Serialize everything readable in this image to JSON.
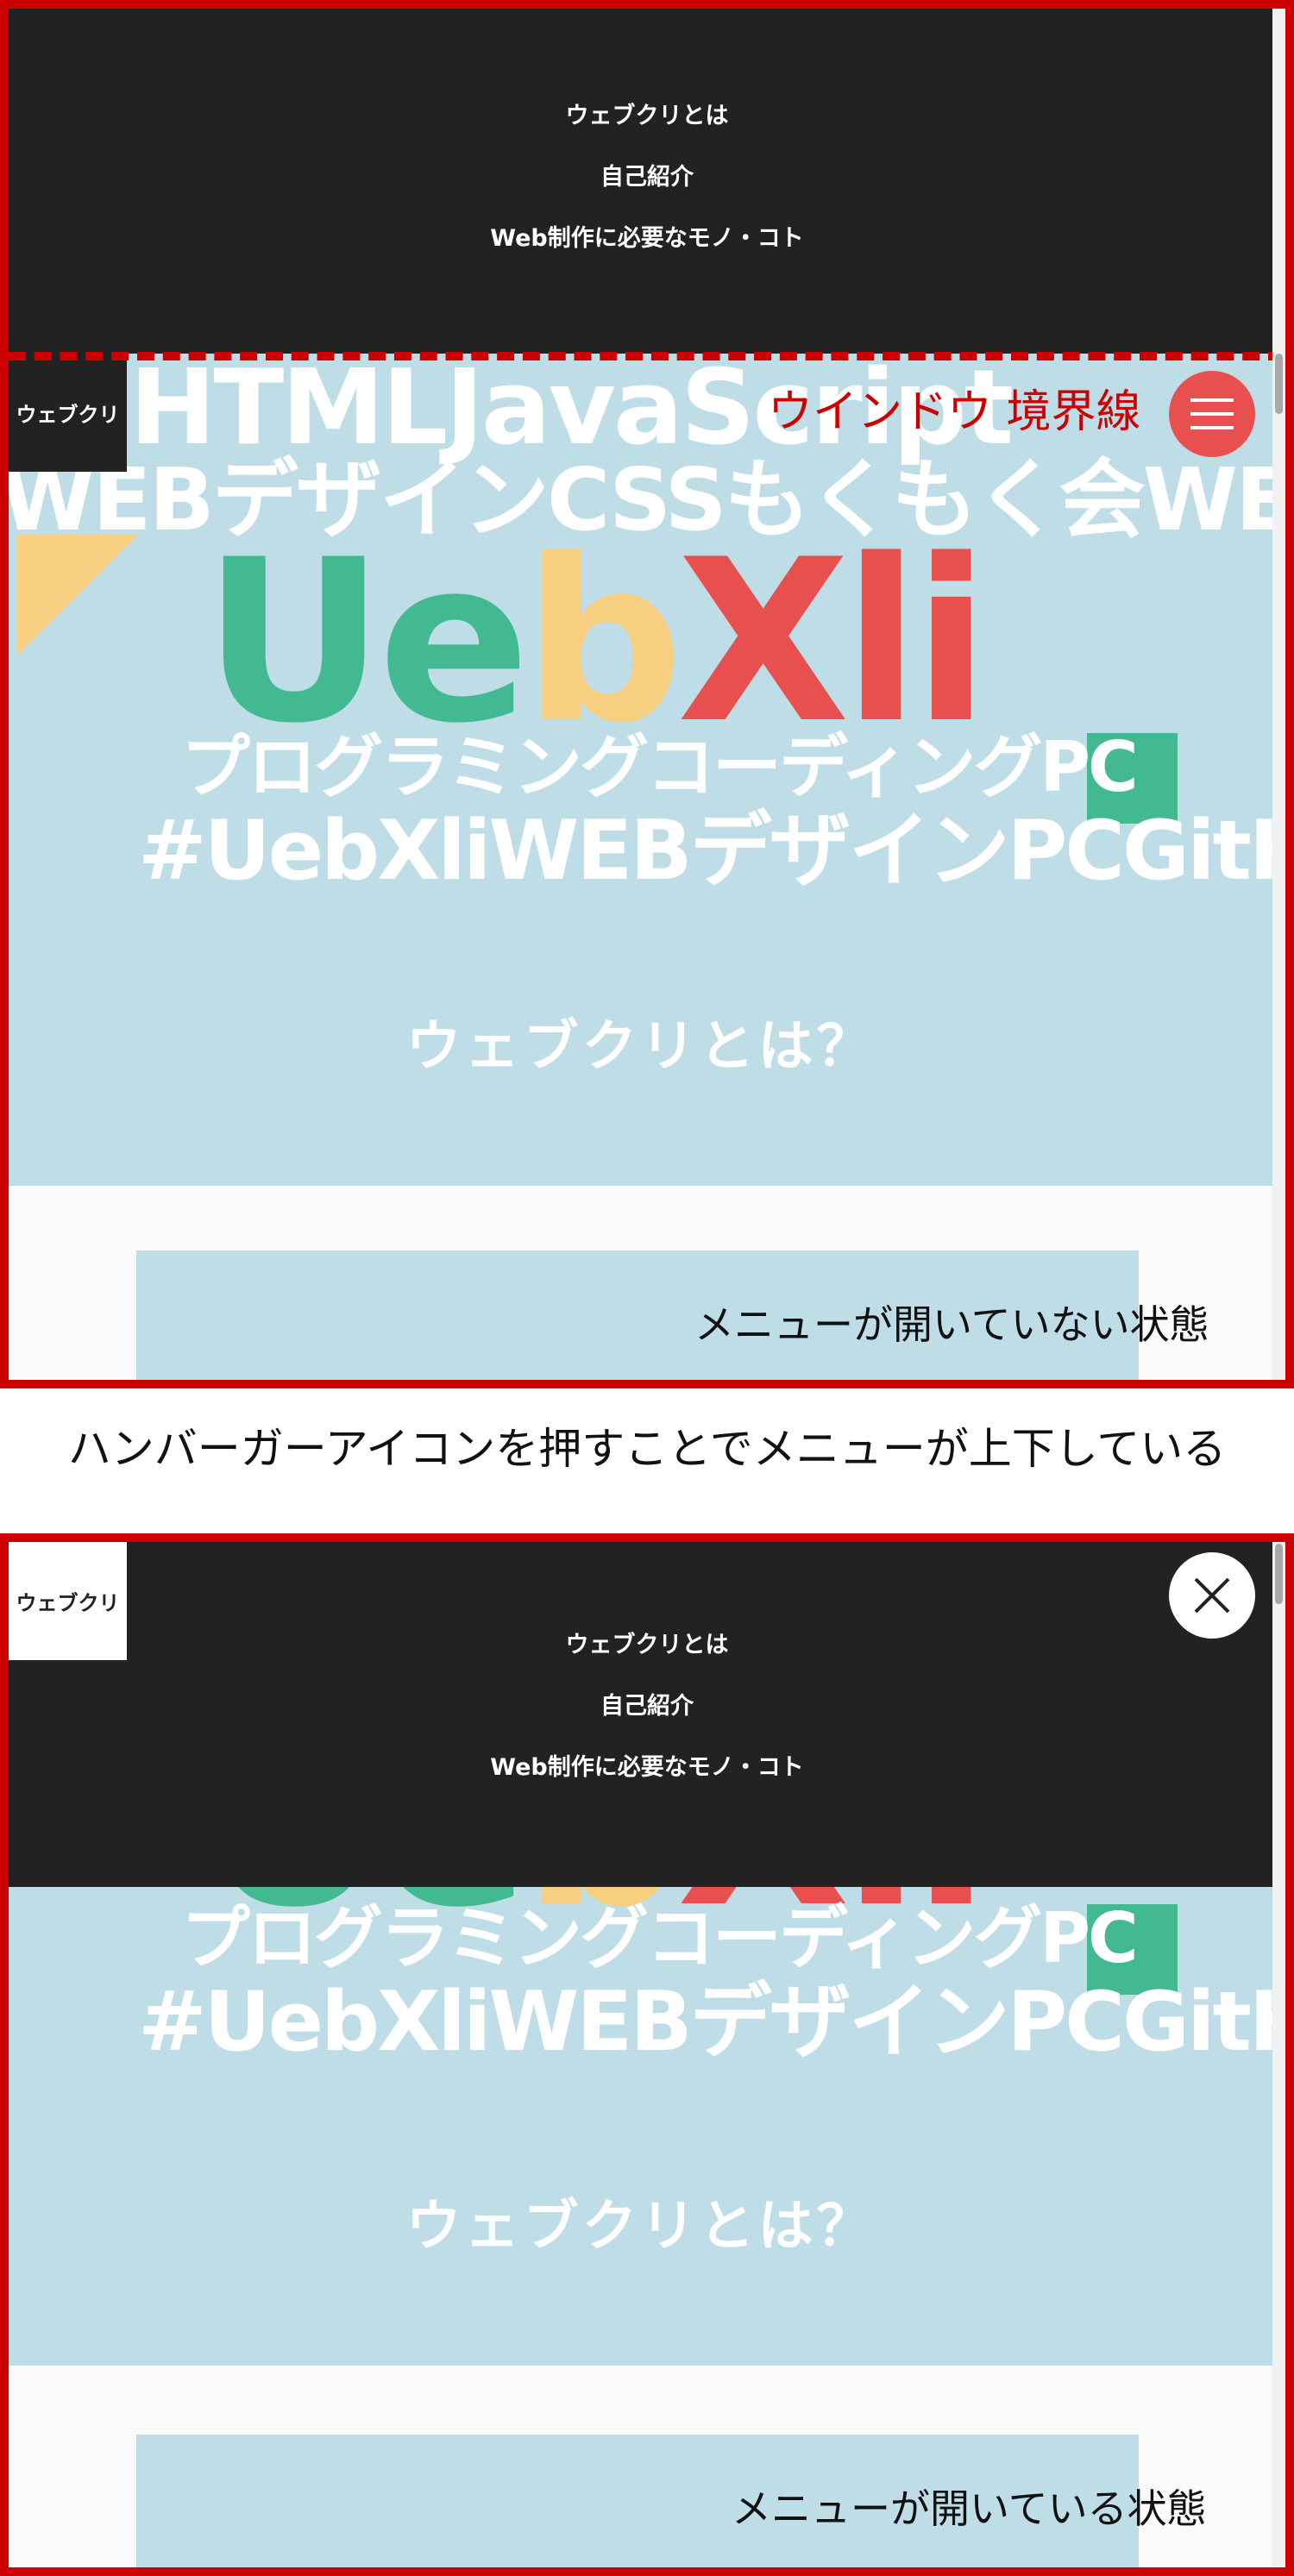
{
  "menu": {
    "items": [
      "ウェブクリとは",
      "自己紹介",
      "Web制作に必要なモノ・コト"
    ]
  },
  "logo": {
    "label": "ウェブクリ"
  },
  "hero": {
    "deco_lines": [
      "HTMLJavaScript",
      "WEBデザインCSSもくもく会WEB制",
      "プログラミングコーディングPC",
      "#UebXliWEBデザインPCGitHub"
    ],
    "big_logo": {
      "part1": "Ueb",
      "part2": "b",
      "part3": "Xli"
    }
  },
  "section": {
    "title": "ウェブクリとは？"
  },
  "annotations": {
    "window_boundary": "ウインドウ 境界線",
    "closed_state": "メニューが開いていない状態",
    "open_state": "メニューが開いている状態",
    "middle_caption": "ハンバーガーアイコンを押すことでメニューが上下している"
  },
  "icons": {
    "hamburger": "hamburger-menu-icon",
    "close": "close-icon"
  },
  "colors": {
    "frame_red": "#cc0000",
    "menu_bg": "#222222",
    "hero_bg": "#bfdde6",
    "logo_green": "#43b992",
    "logo_yellow": "#f7cf80",
    "logo_red": "#e85050"
  }
}
